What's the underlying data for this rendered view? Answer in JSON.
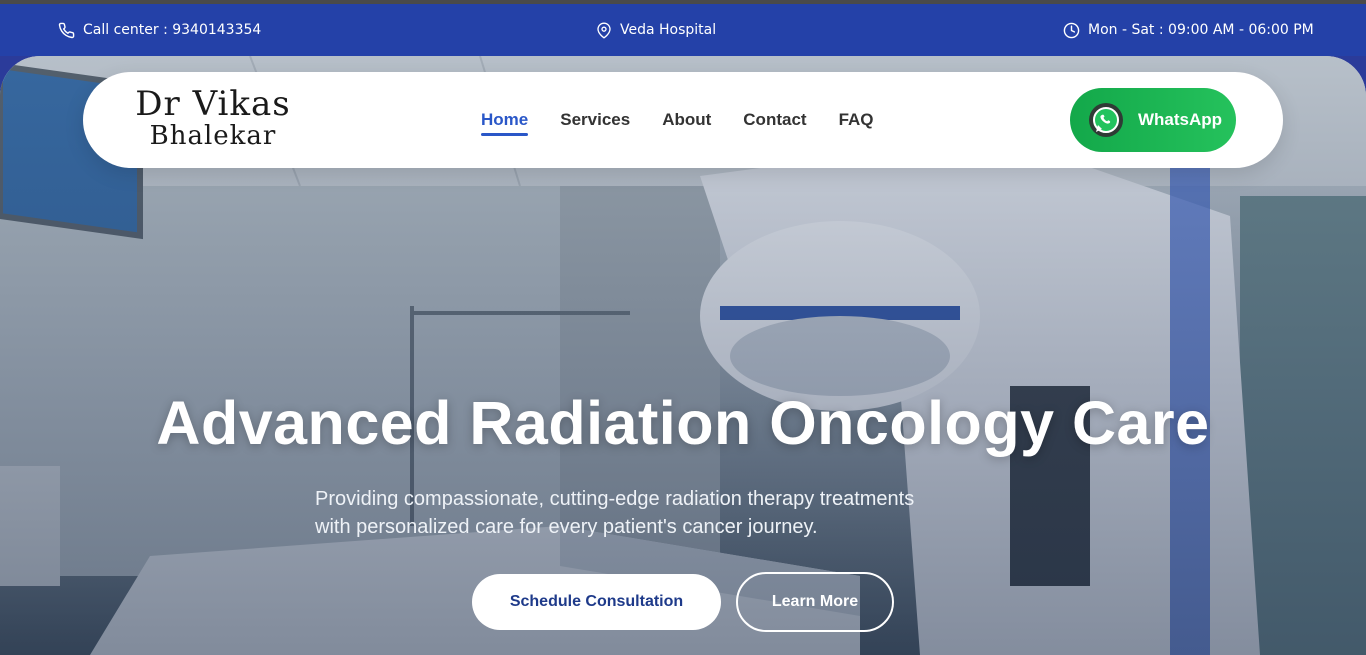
{
  "topbar": {
    "phone": "Call center : 9340143354",
    "location": "Veda Hospital",
    "hours": "Mon - Sat : 09:00 AM - 06:00 PM",
    "icons": [
      "phone-icon",
      "location-pin-icon",
      "clock-icon"
    ]
  },
  "navbar": {
    "logo_line1": "Dr Vikas",
    "logo_line2": "Bhalekar",
    "items": [
      "Home",
      "Services",
      "About",
      "Contact",
      "FAQ"
    ],
    "active_item": "Home",
    "whatsapp_label": "WhatsApp"
  },
  "hero": {
    "title": "Advanced Radiation Oncology Care",
    "subtitle_line1": "Providing compassionate, cutting-edge radiation therapy treatments",
    "subtitle_line2": "with personalized care for every patient's cancer journey.",
    "primary_button": "Schedule Consultation",
    "secondary_button": "Learn More"
  },
  "colors": {
    "topbar": "#2441a8",
    "accent": "#2a57c8",
    "whatsapp": "#25c25c",
    "primary_button_text": "#1e3a8a"
  }
}
